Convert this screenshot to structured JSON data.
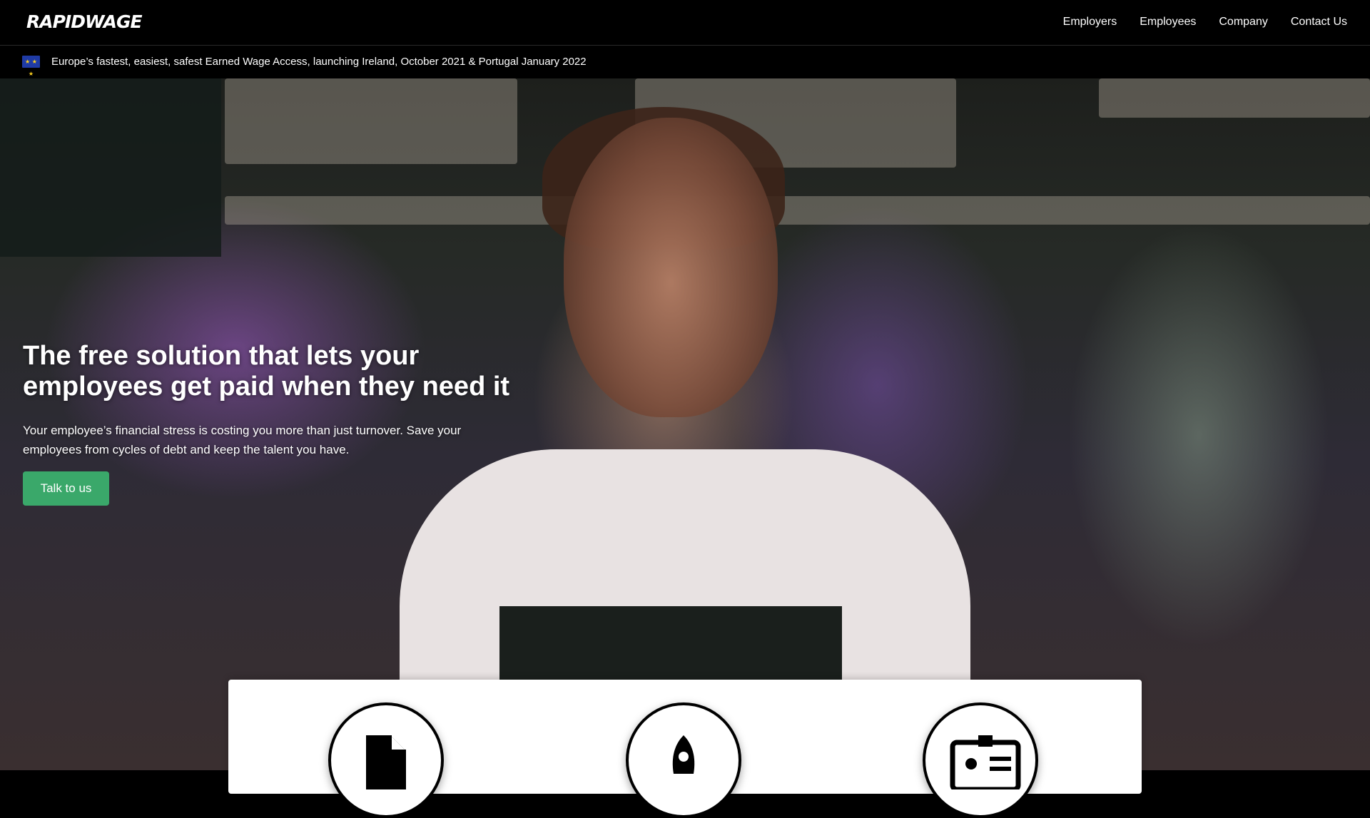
{
  "header": {
    "logo": "RAPIDWAGE",
    "nav": [
      "Employers",
      "Employees",
      "Company",
      "Contact Us"
    ]
  },
  "announcement": {
    "flag_icon": "eu-flag-icon",
    "text": "Europe’s fastest, easiest, safest Earned Wage Access, launching Ireland, October 2021 & Portugal January 2022"
  },
  "hero": {
    "title": "The free solution that lets your employees get paid when they need it",
    "subtitle": "Your employee’s financial stress is costing you more than just turnover. Save your employees from cycles of debt and keep the talent you have.",
    "cta_label": "Talk to us",
    "cta_color": "#3aa86a"
  },
  "features": {
    "icons": [
      "document-icon",
      "rocket-icon",
      "id-card-icon"
    ]
  }
}
